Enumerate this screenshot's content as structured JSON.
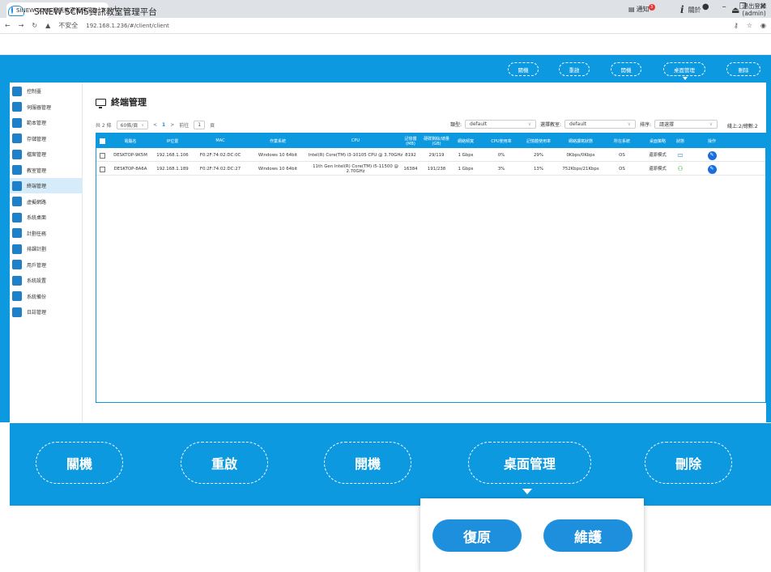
{
  "browser": {
    "tab_title": "SINEW SCMS資訊教室管理平台",
    "url_security": "不安全",
    "url": "192.168.1.236/#/client/client"
  },
  "header": {
    "app_title": "SINEW SCMS資訊教室管理平台",
    "notify_label": "通知",
    "notify_count": "3",
    "about_label": "關於",
    "logout_label": "退出登錄",
    "user": "(admin)"
  },
  "toolbar": {
    "shutdown": "關機",
    "restart": "重啟",
    "poweron": "開機",
    "desktop_mgmt": "桌面管理",
    "delete": "刪除"
  },
  "sidebar": {
    "items": [
      {
        "label": "控制臺",
        "icon": "dashboard-icon"
      },
      {
        "label": "伺服器管理",
        "icon": "server-icon"
      },
      {
        "label": "範本管理",
        "icon": "template-icon"
      },
      {
        "label": "存儲管理",
        "icon": "storage-icon"
      },
      {
        "label": "檔案管理",
        "icon": "file-icon"
      },
      {
        "label": "教室管理",
        "icon": "classroom-icon"
      },
      {
        "label": "終端管理",
        "icon": "terminal-icon"
      },
      {
        "label": "虛擬網路",
        "icon": "network-icon"
      },
      {
        "label": "系統桌面",
        "icon": "desktop-icon"
      },
      {
        "label": "計劃任務",
        "icon": "task-icon"
      },
      {
        "label": "排課計劃",
        "icon": "schedule-icon"
      },
      {
        "label": "用戶管理",
        "icon": "user-icon"
      },
      {
        "label": "系統設置",
        "icon": "settings-icon"
      },
      {
        "label": "系統備份",
        "icon": "backup-icon"
      },
      {
        "label": "日誌管理",
        "icon": "log-icon"
      }
    ]
  },
  "page": {
    "title": "終端管理",
    "total": "共 2 條",
    "page_size": "60條/頁",
    "current_page": "1",
    "goto_prefix": "前往",
    "goto_value": "1",
    "goto_suffix": "頁",
    "type_label": "類型:",
    "type_value": "default",
    "classroom_label": "選擇教室:",
    "classroom_value": "default",
    "sort_label": "排序:",
    "sort_placeholder": "請選擇",
    "online_text": "綫上:2/總數:2"
  },
  "table": {
    "headers": [
      "電腦名",
      "IP位置",
      "MAC",
      "作業系統",
      "CPU",
      "記憶體(MB)",
      "硬碟剩餘/總量(GB)",
      "網絡頻寬",
      "CPU使用率",
      "記憶體使用率",
      "網絡讀寫狀態",
      "所在系統",
      "桌面策略",
      "狀態",
      "操作"
    ],
    "rows": [
      {
        "name": "DESKTOP-9K5M",
        "ip": "192.168.1.106",
        "mac": "F0:2F:74:02:DC:0C",
        "os": "Windows 10 64bit",
        "cpu": "Intel(R) Core(TM) i3-10105 CPU @ 3.70GHz",
        "mem": "8192",
        "disk": "29/119",
        "bw": "1 Gbps",
        "cpu_use": "0%",
        "mem_use": "29%",
        "net": "0Kbps/0Kbps",
        "sys": "OS",
        "policy": "還原模式",
        "status_icon": "monitor-status-icon"
      },
      {
        "name": "DESKTOP-8A6A",
        "ip": "192.168.1.189",
        "mac": "F0:2F:74:02:DC:27",
        "os": "Windows 10 64bit",
        "cpu": "11th Gen Intel(R) Core(TM) i5-11500 @ 2.70GHz",
        "mem": "16384",
        "disk": "191/238",
        "bw": "1 Gbps",
        "cpu_use": "3%",
        "mem_use": "13%",
        "net": "752Kbps/21Kbps",
        "sys": "OS",
        "policy": "還原模式",
        "status_icon": "users-status-icon"
      }
    ]
  },
  "zoom": {
    "shutdown": "關機",
    "restart": "重啟",
    "poweron": "開機",
    "desktop_mgmt": "桌面管理",
    "delete": "刪除",
    "restore": "復原",
    "maintain": "維護"
  },
  "colors": {
    "accent": "#0d99e0",
    "button": "#1d8fdc"
  }
}
